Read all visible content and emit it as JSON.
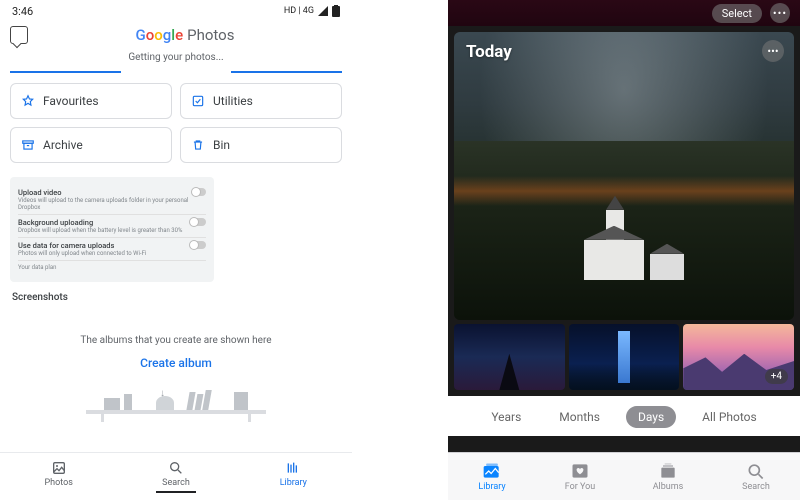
{
  "left": {
    "status": {
      "time": "3:46",
      "network": "HD | 4G"
    },
    "app": {
      "google": "Google",
      "photos": "Photos"
    },
    "loading": "Getting your photos...",
    "chips": {
      "favourites": "Favourites",
      "utilities": "Utilities",
      "archive": "Archive",
      "bin": "Bin"
    },
    "settings": {
      "r1": {
        "title": "Upload video",
        "sub": "Videos will upload to the camera uploads folder in your personal Dropbox"
      },
      "r2": {
        "title": "Background uploading",
        "sub": "Dropbox will upload when the battery level is greater than 30%"
      },
      "r3": {
        "title": "Use data for camera uploads",
        "sub": "Photos will only upload when connected to Wi-Fi"
      },
      "plan": "Your data plan"
    },
    "screenshots_label": "Screenshots",
    "albums_hint": "The albums that you create are shown here",
    "create_album": "Create album",
    "nav": {
      "photos": "Photos",
      "search": "Search",
      "library": "Library"
    }
  },
  "right": {
    "topbar": {
      "select": "Select"
    },
    "hero": {
      "title": "Today"
    },
    "thumbs": {
      "more_badge": "+4"
    },
    "segments": {
      "years": "Years",
      "months": "Months",
      "days": "Days",
      "all": "All Photos"
    },
    "nav": {
      "library": "Library",
      "foryou": "For You",
      "albums": "Albums",
      "search": "Search"
    }
  }
}
